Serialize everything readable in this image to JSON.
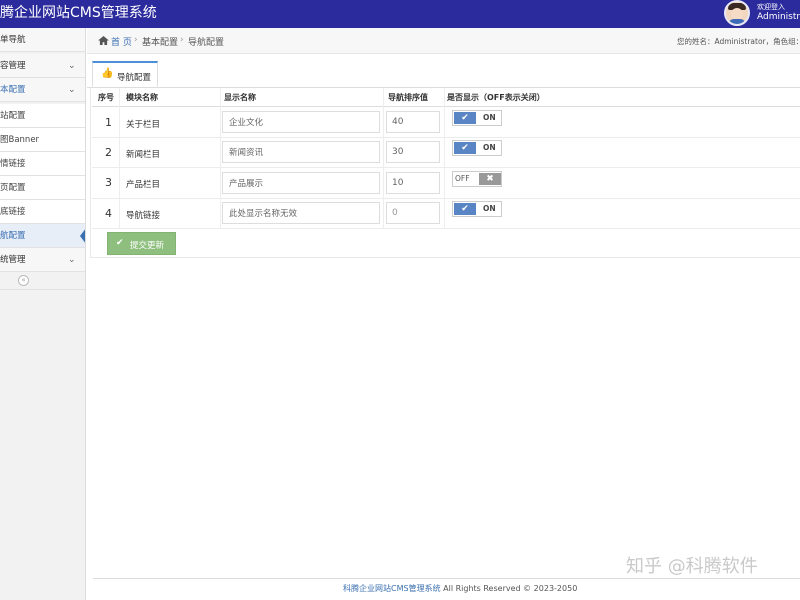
{
  "header": {
    "title": "腾企业网站CMS管理系统",
    "welcome": "欢迎登入",
    "username": "Administr"
  },
  "sidebar": {
    "items": [
      {
        "label": "单导航",
        "type": "section"
      },
      {
        "label": "容管理",
        "type": "section",
        "chevron": "chevron-down-icon"
      },
      {
        "label": "本配置",
        "type": "section",
        "chevron": "chevron-down-icon"
      },
      {
        "label": "站配置",
        "type": "sub"
      },
      {
        "label": "图Banner",
        "type": "sub"
      },
      {
        "label": "情链接",
        "type": "sub"
      },
      {
        "label": "页配置",
        "type": "sub"
      },
      {
        "label": "底链接",
        "type": "sub"
      },
      {
        "label": "航配置",
        "type": "sub",
        "active": true
      },
      {
        "label": "统管理",
        "type": "section",
        "chevron": "chevron-down-icon"
      }
    ],
    "collapse_icon": "«"
  },
  "breadcrumb": {
    "home": "首 页",
    "sep": "›",
    "level2": "基本配置",
    "level3": "导航配置",
    "user_info": "您的姓名：Administrator，角色组："
  },
  "tab": {
    "label": "导航配置"
  },
  "table": {
    "headers": [
      "序号",
      "模块名称",
      "显示名称",
      "导航排序值",
      "是否显示（OFF表示关闭）"
    ],
    "rows": [
      {
        "no": "1",
        "module": "关于栏目",
        "display": "企业文化",
        "order": "40",
        "show": "ON"
      },
      {
        "no": "2",
        "module": "新闻栏目",
        "display": "新闻资讯",
        "order": "30",
        "show": "ON"
      },
      {
        "no": "3",
        "module": "产品栏目",
        "display": "产品展示",
        "order": "10",
        "show": "OFF"
      },
      {
        "no": "4",
        "module": "导航链接",
        "display": "此处显示名称无效",
        "order": "0",
        "show": "ON"
      }
    ],
    "switch_on": "ON",
    "switch_off": "OFF",
    "check_glyph": "✔",
    "x_glyph": "✖"
  },
  "submit": {
    "label": "提交更新",
    "icon_glyph": "✔"
  },
  "footer": {
    "brand": "科腾企业网站CMS管理系统",
    "rights": " All Rights Reserved © 2023-2050"
  },
  "watermark": "知乎 @科腾软件"
}
